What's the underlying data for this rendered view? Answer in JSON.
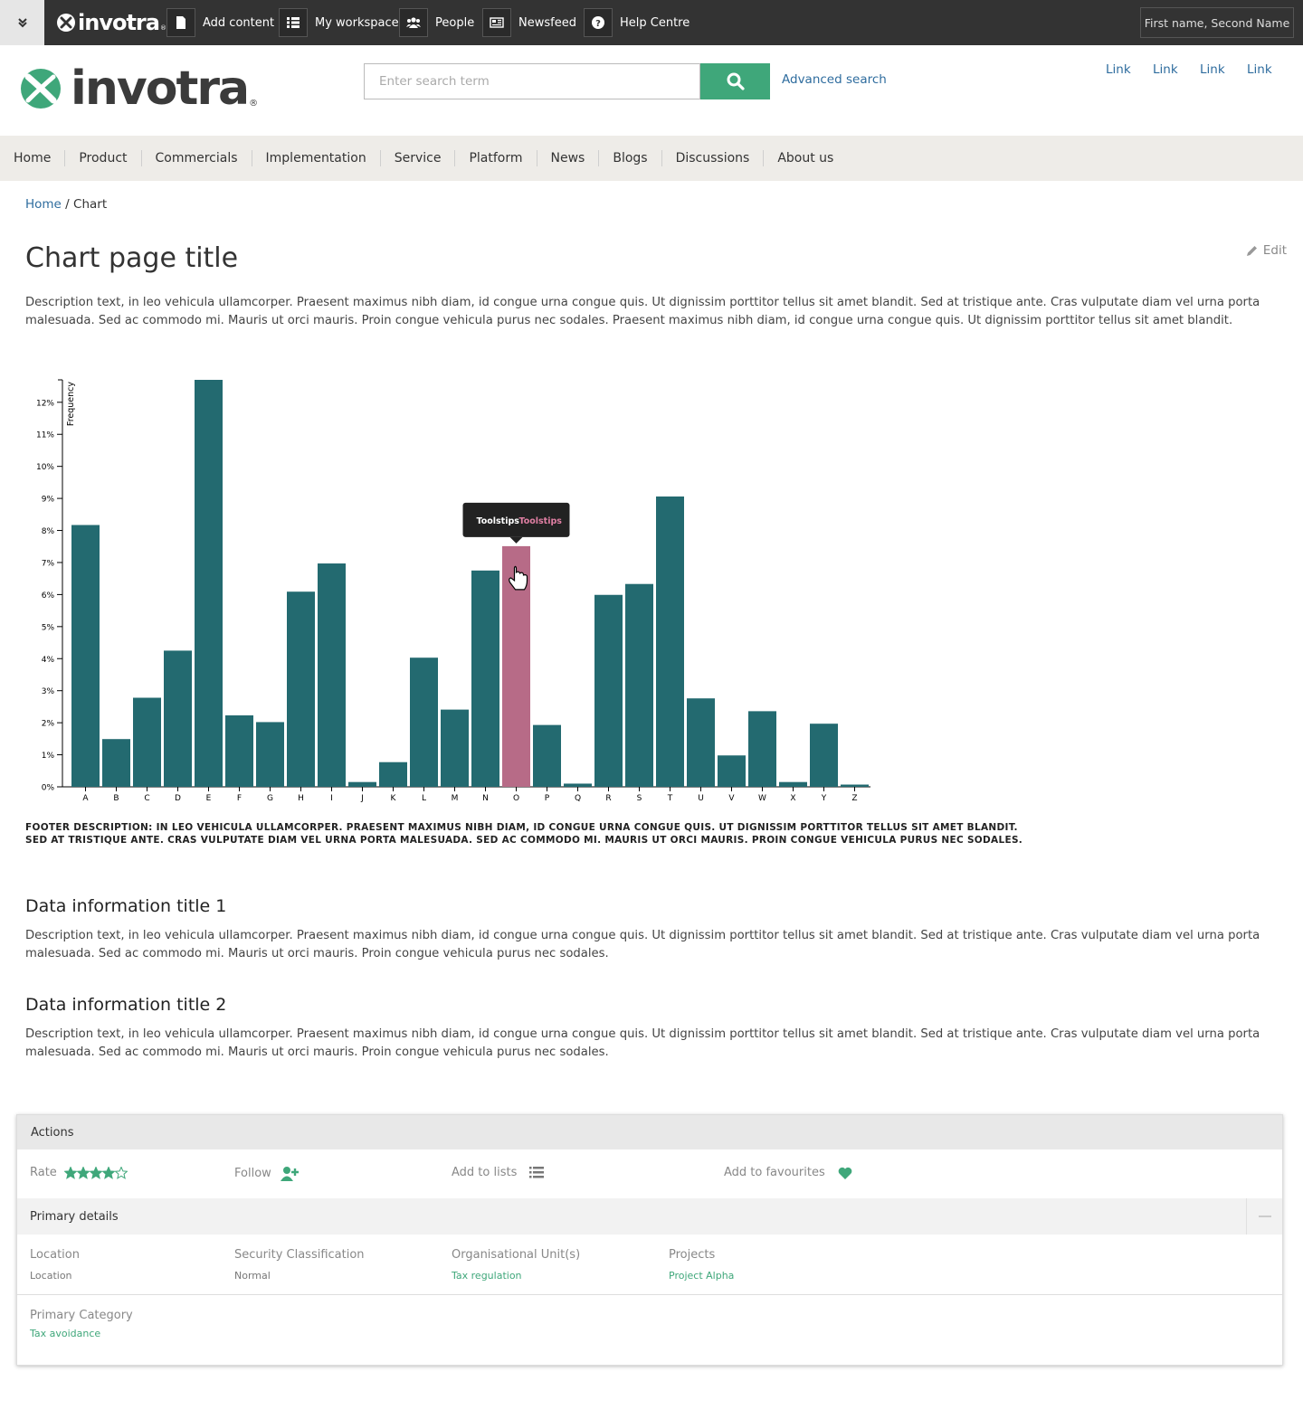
{
  "topbar": {
    "brand": "invotra",
    "items": [
      {
        "label": "Add content",
        "icon": "document-icon"
      },
      {
        "label": "My workspace",
        "icon": "list-icon"
      },
      {
        "label": "People",
        "icon": "people-icon"
      },
      {
        "label": "Newsfeed",
        "icon": "newspaper-icon"
      },
      {
        "label": "Help Centre",
        "icon": "question-icon"
      }
    ],
    "user": "First name, Second Name"
  },
  "header": {
    "brand": "invotra",
    "search_placeholder": "Enter search term",
    "advanced_search": "Advanced search",
    "links": [
      "Link",
      "Link",
      "Link",
      "Link"
    ]
  },
  "nav": [
    "Home",
    "Product",
    "Commercials",
    "Implementation",
    "Service",
    "Platform",
    "News",
    "Blogs",
    "Discussions",
    "About us"
  ],
  "breadcrumb": {
    "home": "Home",
    "current": "/ Chart"
  },
  "page": {
    "title": "Chart page title",
    "edit": "Edit",
    "description": "Description text, in leo vehicula ullamcorper. Praesent maximus nibh diam, id congue urna congue quis. Ut dignissim porttitor tellus sit amet blandit. Sed at tristique ante. Cras vulputate diam vel urna porta malesuada. Sed ac commodo mi. Mauris ut orci mauris. Proin congue vehicula purus nec sodales. Praesent maximus nibh diam, id congue urna congue quis. Ut dignissim porttitor tellus sit amet blandit.",
    "chart_footer": "FOOTER DESCRIPTION: IN LEO VEHICULA ULLAMCORPER. PRAESENT MAXIMUS NIBH DIAM, ID CONGUE URNA CONGUE QUIS. UT DIGNISSIM PORTTITOR TELLUS SIT AMET BLANDIT. SED AT TRISTIQUE ANTE. CRAS VULPUTATE DIAM VEL URNA PORTA MALESUADA. SED AC COMMODO MI. MAURIS UT ORCI MAURIS. PROIN CONGUE VEHICULA PURUS NEC SODALES.",
    "sections": [
      {
        "title": "Data information title 1",
        "text": "Description text, in leo vehicula ullamcorper. Praesent maximus nibh diam, id congue urna congue quis. Ut dignissim porttitor tellus sit amet blandit. Sed at tristique ante. Cras vulputate diam vel urna porta malesuada. Sed ac commodo mi. Mauris ut orci mauris. Proin congue vehicula purus nec sodales."
      },
      {
        "title": "Data information title 2",
        "text": "Description text, in leo vehicula ullamcorper. Praesent maximus nibh diam, id congue urna congue quis. Ut dignissim porttitor tellus sit amet blandit. Sed at tristique ante. Cras vulputate diam vel urna porta malesuada. Sed ac commodo mi. Mauris ut orci mauris. Proin congue vehicula purus nec sodales."
      }
    ]
  },
  "chart_data": {
    "type": "bar",
    "categories": [
      "A",
      "B",
      "C",
      "D",
      "E",
      "F",
      "G",
      "H",
      "I",
      "J",
      "K",
      "L",
      "M",
      "N",
      "O",
      "P",
      "Q",
      "R",
      "S",
      "T",
      "U",
      "V",
      "W",
      "X",
      "Y",
      "Z"
    ],
    "values": [
      8.17,
      1.49,
      2.78,
      4.25,
      12.7,
      2.23,
      2.02,
      6.09,
      6.97,
      0.15,
      0.77,
      4.03,
      2.41,
      6.75,
      7.51,
      1.93,
      0.1,
      5.99,
      6.33,
      9.06,
      2.76,
      0.98,
      2.36,
      0.15,
      1.97,
      0.07
    ],
    "ylabel": "Frequency",
    "yticks": [
      "0%",
      "1%",
      "2%",
      "3%",
      "4%",
      "5%",
      "6%",
      "7%",
      "8%",
      "9%",
      "10%",
      "11%",
      "12%"
    ],
    "ylim": [
      0,
      12.7
    ],
    "highlight_index": 14,
    "tooltip": {
      "label": "Toolstips",
      "value": "Toolstips"
    },
    "colors": {
      "bar": "#236a70",
      "highlight": "#b76b87",
      "tooltip_bg": "#222222",
      "tooltip_value": "#e07fa3"
    }
  },
  "actions": {
    "title": "Actions",
    "rate_label": "Rate",
    "rating": 4,
    "rating_max": 5,
    "follow": "Follow",
    "add_to_lists": "Add to lists",
    "add_to_favourites": "Add to favourites"
  },
  "primary_details": {
    "title": "Primary details",
    "fields": [
      {
        "label": "Location",
        "value": "Location"
      },
      {
        "label": "Security Classification",
        "value": "Normal"
      },
      {
        "label": "Organisational Unit(s)",
        "value": "Tax regulation"
      },
      {
        "label": "Projects",
        "value": "Project Alpha"
      }
    ],
    "category_label": "Primary Category",
    "category_value": "Tax avoidance"
  },
  "colors": {
    "accent": "#3fa77a",
    "link": "#2e6c9e",
    "topbar": "#333333"
  }
}
